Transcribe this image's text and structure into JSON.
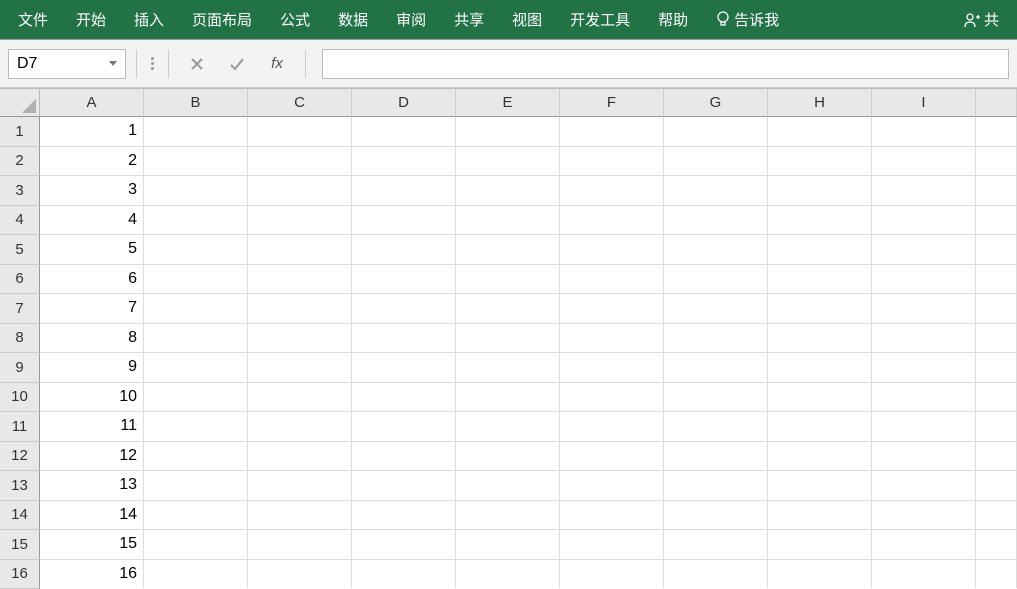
{
  "ribbon": {
    "tabs": [
      "文件",
      "开始",
      "插入",
      "页面布局",
      "公式",
      "数据",
      "审阅",
      "共享",
      "视图",
      "开发工具",
      "帮助"
    ],
    "tellme": "告诉我",
    "share": "共"
  },
  "formula_bar": {
    "name_box": "D7",
    "fx_label": "fx",
    "formula_value": ""
  },
  "sheet": {
    "columns": [
      "A",
      "B",
      "C",
      "D",
      "E",
      "F",
      "G",
      "H",
      "I"
    ],
    "row_count": 16,
    "data": {
      "A": [
        "1",
        "2",
        "3",
        "4",
        "5",
        "6",
        "7",
        "8",
        "9",
        "10",
        "11",
        "12",
        "13",
        "14",
        "15",
        "16"
      ]
    }
  }
}
